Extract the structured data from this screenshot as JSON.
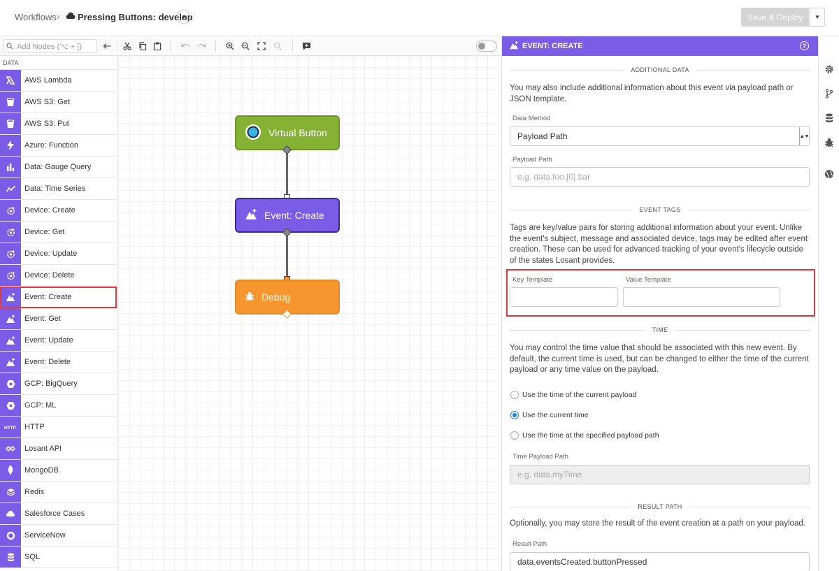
{
  "breadcrumb": {
    "root": "Workflows",
    "separator": "›",
    "current": "Pressing Buttons: develop"
  },
  "actions": {
    "deploy_label": "Save & Deploy"
  },
  "toolbar": {
    "search_placeholder": "Add Nodes (⌥ + [)"
  },
  "palette": {
    "section": "DATA",
    "items": [
      {
        "label": "AWS Lambda",
        "icon": "aws-lambda-icon"
      },
      {
        "label": "AWS S3: Get",
        "icon": "bucket-icon"
      },
      {
        "label": "AWS S3: Put",
        "icon": "bucket-icon"
      },
      {
        "label": "Azure: Function",
        "icon": "bolt-icon"
      },
      {
        "label": "Data: Gauge Query",
        "icon": "bar-chart-icon"
      },
      {
        "label": "Data: Time Series",
        "icon": "line-chart-icon"
      },
      {
        "label": "Device: Create",
        "icon": "device-icon"
      },
      {
        "label": "Device: Get",
        "icon": "device-icon"
      },
      {
        "label": "Device: Update",
        "icon": "device-icon"
      },
      {
        "label": "Device: Delete",
        "icon": "device-icon"
      },
      {
        "label": "Event: Create",
        "icon": "event-icon"
      },
      {
        "label": "Event: Get",
        "icon": "event-icon"
      },
      {
        "label": "Event: Update",
        "icon": "event-icon"
      },
      {
        "label": "Event: Delete",
        "icon": "event-icon"
      },
      {
        "label": "GCP: BigQuery",
        "icon": "hexagon-icon"
      },
      {
        "label": "GCP: ML",
        "icon": "hexagon-icon"
      },
      {
        "label": "HTTP",
        "icon": "http-icon"
      },
      {
        "label": "Losant API",
        "icon": "losant-icon"
      },
      {
        "label": "MongoDB",
        "icon": "leaf-icon"
      },
      {
        "label": "Redis",
        "icon": "layers-icon"
      },
      {
        "label": "Salesforce Cases",
        "icon": "cloud-icon"
      },
      {
        "label": "ServiceNow",
        "icon": "ring-icon"
      },
      {
        "label": "SQL",
        "icon": "database-icon"
      }
    ]
  },
  "nodes": {
    "virtual_button": "Virtual Button",
    "event_create": "Event: Create",
    "debug": "Debug"
  },
  "panel": {
    "title": "EVENT: CREATE",
    "additional": {
      "heading": "ADDITIONAL DATA",
      "text": "You may also include additional information about this event via payload path or JSON template.",
      "method_label": "Data Method",
      "method_value": "Payload Path",
      "path_label": "Payload Path",
      "path_placeholder": "e.g. data.foo.[0].bar"
    },
    "tags": {
      "heading": "EVENT TAGS",
      "text": "Tags are key/value pairs for storing additional information about your event. Unlike the event's subject, message and associated device, tags may be edited after event creation. These can be used for advanced tracking of your event's lifecycle outside of the states Losant provides.",
      "key_label": "Key Template",
      "value_label": "Value Template"
    },
    "time": {
      "heading": "TIME",
      "text": "You may control the time value that should be associated with this new event. By default, the current time is used, but can be changed to either the time of the current payload or any time value on the payload.",
      "options": [
        "Use the time of the current payload",
        "Use the current time",
        "Use the time at the specified payload path"
      ],
      "selected": "Use the current time",
      "path_label": "Time Payload Path",
      "path_placeholder": "e.g. data.myTime"
    },
    "result": {
      "heading": "RESULT PATH",
      "text": "Optionally, you may store the result of the event creation at a path on your payload.",
      "label": "Result Path",
      "value": "data.eventsCreated.buttonPressed"
    }
  }
}
